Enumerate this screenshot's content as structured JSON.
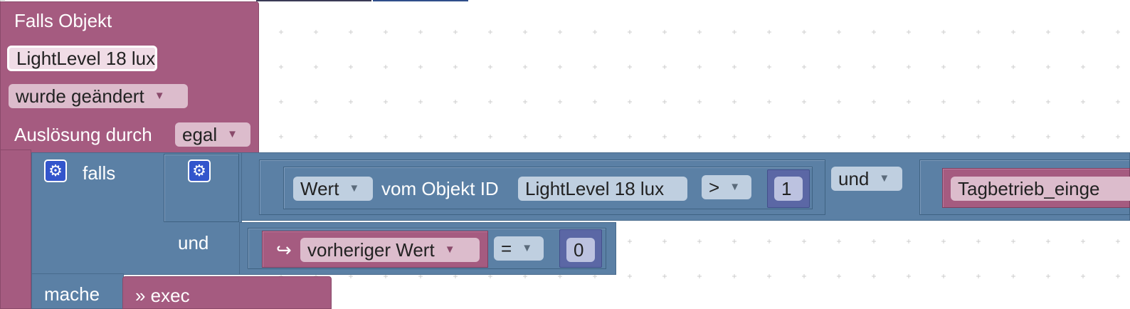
{
  "event_block": {
    "title": "Falls Objekt",
    "object_name": "LightLevel 18 lux",
    "condition_dropdown": "wurde geändert",
    "trigger_label": "Auslösung durch",
    "trigger_dropdown": "egal",
    "do_label": "mache"
  },
  "if_block": {
    "if_label": "falls",
    "and_label": "und",
    "settings_icon": "gear-icon",
    "and_block_settings_icon": "gear-icon",
    "compare1": {
      "value_dropdown": "Wert",
      "from_object_label": "vom Objekt ID",
      "object_name": "LightLevel 18 lux",
      "operator": ">",
      "number": "1"
    },
    "logic_operator": "und",
    "compare2_object": "Tagbetrieb_einge",
    "compare3": {
      "arrow_icon": "↪",
      "prev_value_dropdown": "vorheriger Wert",
      "operator": "=",
      "number": "0"
    }
  },
  "exec_block": {
    "label": "» exec"
  },
  "dropdown_icon": "▼",
  "colors": {
    "event": "#a55b80",
    "logic": "#5b80a5",
    "math": "#5b67a5",
    "workspace": "#ffffff"
  }
}
